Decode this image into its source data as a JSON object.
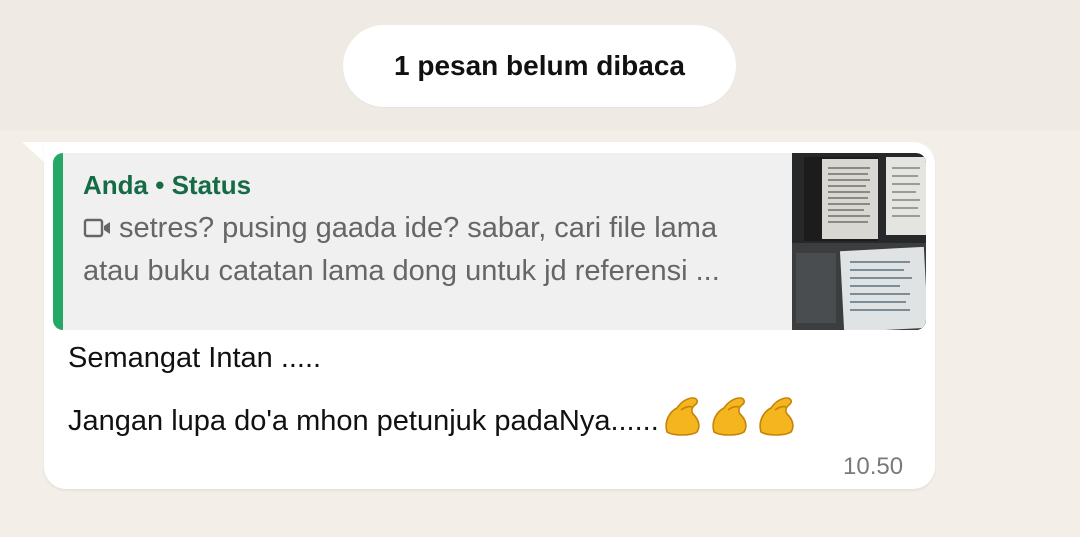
{
  "unread_banner": {
    "label": "1 pesan belum dibaca"
  },
  "message": {
    "quote": {
      "author": "Anda",
      "separator": "•",
      "source": "Status",
      "media_icon": "video-icon",
      "text": "setres? pusing gaada ide? sabar, cari file lama atau buku catatan lama dong untuk jd referensi ..."
    },
    "lines": [
      "Semangat Intan .....",
      "Jangan lupa do'a mhon petunjuk padaNya......"
    ],
    "emoji": "flexed-biceps-emoji",
    "emoji_count": 3,
    "time": "10.50"
  },
  "colors": {
    "background": "#f3efe8",
    "bubble": "#ffffff",
    "quote_bar": "#25a865",
    "quote_author": "#156b45"
  }
}
